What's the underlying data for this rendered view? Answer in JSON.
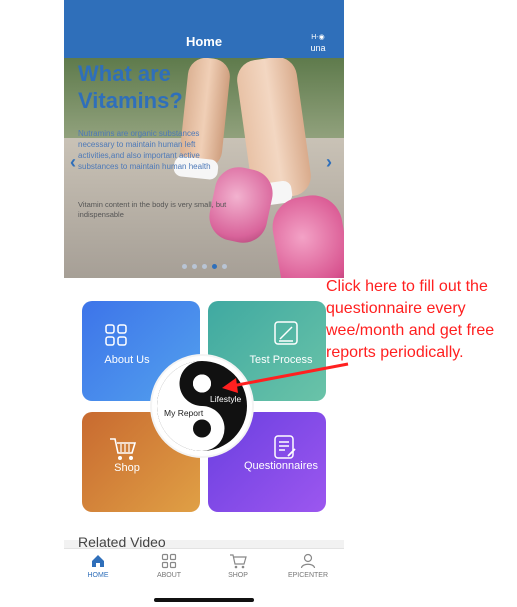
{
  "header": {
    "title": "Home",
    "user_icon_text": "H-◉",
    "user_name": "una"
  },
  "banner": {
    "title_line1": "What are",
    "title_line2": "Vitamins?",
    "paragraph": "Nutramins are organic substances necessary to maintain human left activities,and also important active substances to maintain human health",
    "paragraph2": "Vitamin content in the body is very small, but indispensable",
    "prev": "‹",
    "next": "›",
    "slide_count": 5,
    "active_slide": 3
  },
  "tiles": {
    "about": "About Us",
    "test": "Test Process",
    "shop": "Shop",
    "questionnaires": "Questionnaires",
    "center_lifestyle": "Lifestyle",
    "center_report": "My Report"
  },
  "related": "Related Video",
  "nav": {
    "home": "HOME",
    "about": "ABOUT",
    "shop": "SHOP",
    "epicenter": "EPICENTER"
  },
  "annotation": "Click here to fill out the questionnaire every wee/month and get free reports periodically.",
  "colors": {
    "header": "#2f6fba",
    "annotation": "#ff2020",
    "nav_active": "#2f6fba"
  },
  "icons": [
    "grid-icon",
    "document-edit-icon",
    "cart-icon",
    "list-edit-icon",
    "yin-yang-icon",
    "home-icon",
    "person-icon",
    "chevron-left-icon",
    "chevron-right-icon"
  ]
}
